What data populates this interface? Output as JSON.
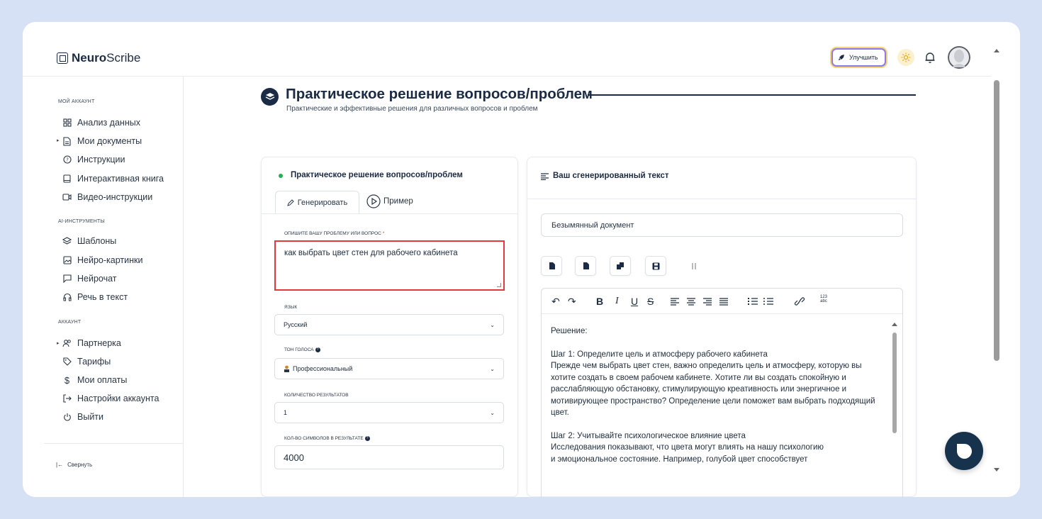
{
  "app": {
    "logo_bold": "Neuro",
    "logo_rest": "Scribe",
    "upgrade_label": "Улучшить"
  },
  "sidebar": {
    "sections": [
      {
        "title": "МОЙ АККАУНТ",
        "items": [
          {
            "label": "Анализ данных",
            "icon": "grid-icon"
          },
          {
            "label": "Мои документы",
            "icon": "document-icon",
            "expandable": true
          },
          {
            "label": "Инструкции",
            "icon": "help-circle-icon"
          },
          {
            "label": "Интерактивная книга",
            "icon": "book-icon"
          },
          {
            "label": "Видео-инструкции",
            "icon": "video-icon"
          }
        ]
      },
      {
        "title": "AI-ИНСТРУМЕНТЫ",
        "items": [
          {
            "label": "Шаблоны",
            "icon": "layers-icon"
          },
          {
            "label": "Нейро-картинки",
            "icon": "image-icon"
          },
          {
            "label": "Нейрочат",
            "icon": "chat-icon"
          },
          {
            "label": "Речь в текст",
            "icon": "headphones-icon"
          }
        ]
      },
      {
        "title": "АККАУНТ",
        "items": [
          {
            "label": "Партнерка",
            "icon": "users-icon",
            "expandable": true
          },
          {
            "label": "Тарифы",
            "icon": "tag-icon"
          },
          {
            "label": "Мои оплаты",
            "icon": "dollar-icon"
          },
          {
            "label": "Настройки аккаунта",
            "icon": "login-icon"
          },
          {
            "label": "Выйти",
            "icon": "power-icon"
          }
        ]
      }
    ],
    "collapse_label": "Свернуть"
  },
  "page": {
    "title": "Практическое решение вопросов/проблем",
    "subtitle": "Практические и эффективные решения для различных вопросов и проблем"
  },
  "form": {
    "card_title": "Практическое решение вопросов/проблем",
    "tab_generate": "Генерировать",
    "tab_example": "Пример",
    "problem_label": "ОПИШИТЕ ВАШУ ПРОБЛЕМУ ИЛИ ВОПРОС",
    "problem_required_mark": "*",
    "problem_value": "как выбрать цвет стен для рабочего кабинета",
    "language_label": "ЯЗЫК",
    "language_value": "Русский",
    "tone_label": "ТОН ГОЛОСА",
    "tone_value": "Профессиональный",
    "results_label": "КОЛИЧЕСТВО РЕЗУЛЬТАТОВ",
    "results_value": "1",
    "chars_label": "КОЛ-ВО СИМВОЛОВ В РЕЗУЛЬТАТЕ",
    "chars_value": "4000"
  },
  "output": {
    "card_title": "Ваш сгенерированный текст",
    "doc_name": "Безымянный документ",
    "paragraphs": [
      "Решение:",
      "Шаг 1: Определите цель и атмосферу рабочего кабинета\nПрежде чем выбрать цвет стен, важно определить цель и атмосферу, которую вы хотите создать в своем рабочем кабинете. Хотите ли вы создать спокойную и расслабляющую обстановку, стимулирующую креативность или энергичное и мотивирующее пространство? Определение цели поможет вам выбрать подходящий цвет.",
      "Шаг 2: Учитывайте психологическое влияние цвета\nИсследования показывают, что цвета могут влиять на нашу психологию\nи эмоциональное состояние. Например, голубой цвет способствует"
    ],
    "toolbar_extra_label": "123 abc"
  },
  "colors": {
    "accent": "#1b2b45",
    "highlight_border": "#e53935",
    "status_dot": "#22b14c",
    "background": "#d7e1f5"
  }
}
